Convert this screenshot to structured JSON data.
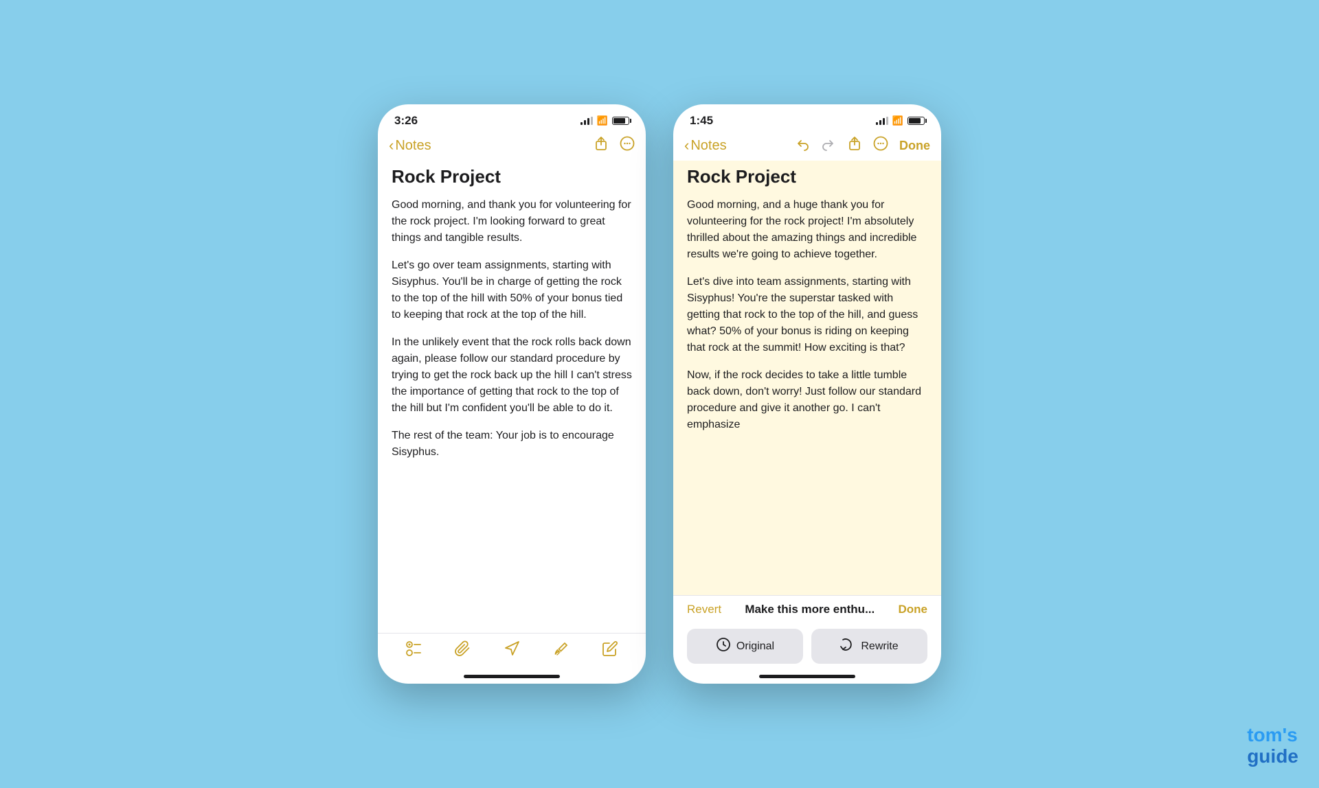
{
  "left_phone": {
    "status": {
      "time": "3:26"
    },
    "nav": {
      "back_label": "Notes",
      "icon_share": "↑",
      "icon_more": "···"
    },
    "note": {
      "title": "Rock Project",
      "para1": "Good morning, and thank you for volunteering for the rock project. I'm looking forward to great things and tangible results.",
      "para2": "Let's go over team assignments, starting with Sisyphus. You'll be in charge of getting the rock to the top of the hill with 50% of your bonus tied to keeping that rock at the top of the hill.",
      "para3": "In the unlikely event that the rock rolls back down again, please follow our standard procedure by trying to get the rock back up the hill I can't stress the importance of getting that rock to the top of the hill but I'm confident you'll be able to do it.",
      "para4": "The rest of the team: Your job is to encourage Sisyphus."
    },
    "toolbar": {
      "icon1": "checklist",
      "icon2": "paperclip",
      "icon3": "compose",
      "icon4": "brush",
      "icon5": "edit"
    }
  },
  "right_phone": {
    "status": {
      "time": "1:45"
    },
    "nav": {
      "back_label": "Notes",
      "done_label": "Done"
    },
    "note": {
      "title": "Rock Project",
      "para1": "Good morning, and a huge thank you for volunteering for the rock project! I'm absolutely thrilled about the amazing things and incredible results we're going to achieve together.",
      "para2": "Let's dive into team assignments, starting with Sisyphus! You're the superstar tasked with getting that rock to the top of the hill, and guess what? 50% of your bonus is riding on keeping that rock at the summit! How exciting is that?",
      "para3": "Now, if the rock decides to take a little tumble back down, don't worry! Just follow our standard procedure and give it another go. I can't emphasize"
    },
    "ai_bar": {
      "revert": "Revert",
      "prompt": "Make this more enthu...",
      "done": "Done"
    },
    "ai_buttons": {
      "original_label": "Original",
      "rewrite_label": "Rewrite"
    }
  },
  "watermark": {
    "line1": "tom's",
    "line2": "guide"
  }
}
